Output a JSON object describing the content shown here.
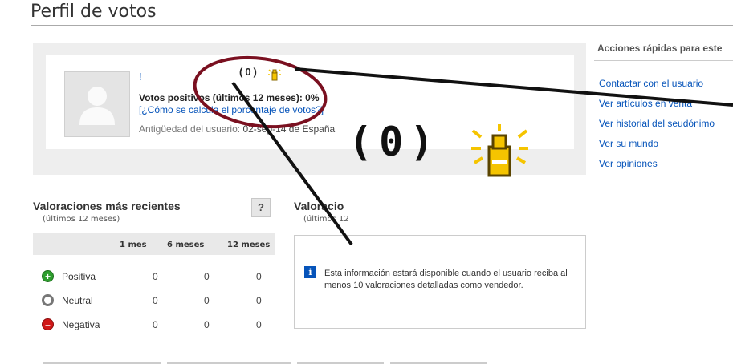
{
  "page": {
    "title": "Perfil de votos"
  },
  "profile": {
    "username": "!",
    "score_small": "(0)",
    "votes_label": "Votos positivos (últimos 12 meses): 0%",
    "how_calc_link": "[¿Cómo se calcula el porcentaje de votos?]",
    "member_since_label": "Antigüedad del usuario:",
    "member_since_value": "02-sep-14 de España",
    "score_big": "(0)"
  },
  "sidebar": {
    "title": "Acciones rápidas para este",
    "links": [
      {
        "label": "Contactar con el usuario"
      },
      {
        "label": "Ver artículos en venta"
      },
      {
        "label": "Ver historial del seudónimo"
      },
      {
        "label": "Ver su mundo"
      },
      {
        "label": "Ver opiniones"
      }
    ]
  },
  "recent": {
    "title": "Valoraciones más recientes",
    "subtitle": "(últimos 12 meses)",
    "help": "?",
    "columns": [
      "1 mes",
      "6 meses",
      "12 meses"
    ],
    "rows": [
      {
        "label": "Positiva",
        "icon": "plus-circle-icon",
        "color": "#2e9e2e",
        "values": [
          "0",
          "0",
          "0"
        ]
      },
      {
        "label": "Neutral",
        "icon": "neutral-circle-icon",
        "color": "#888888",
        "values": [
          "0",
          "0",
          "0"
        ]
      },
      {
        "label": "Negativa",
        "icon": "minus-circle-icon",
        "color": "#d01818",
        "values": [
          "0",
          "0",
          "0"
        ]
      }
    ]
  },
  "detailed": {
    "title": "Valoracio",
    "subtitle": "(últimos 12",
    "info_text": "Esta información estará disponible cuando el usuario reciba al menos 10 valoraciones detalladas como vendedor."
  },
  "colors": {
    "link": "#0654ba",
    "annotation": "#7a1020",
    "star_yellow": "#f5c400"
  }
}
